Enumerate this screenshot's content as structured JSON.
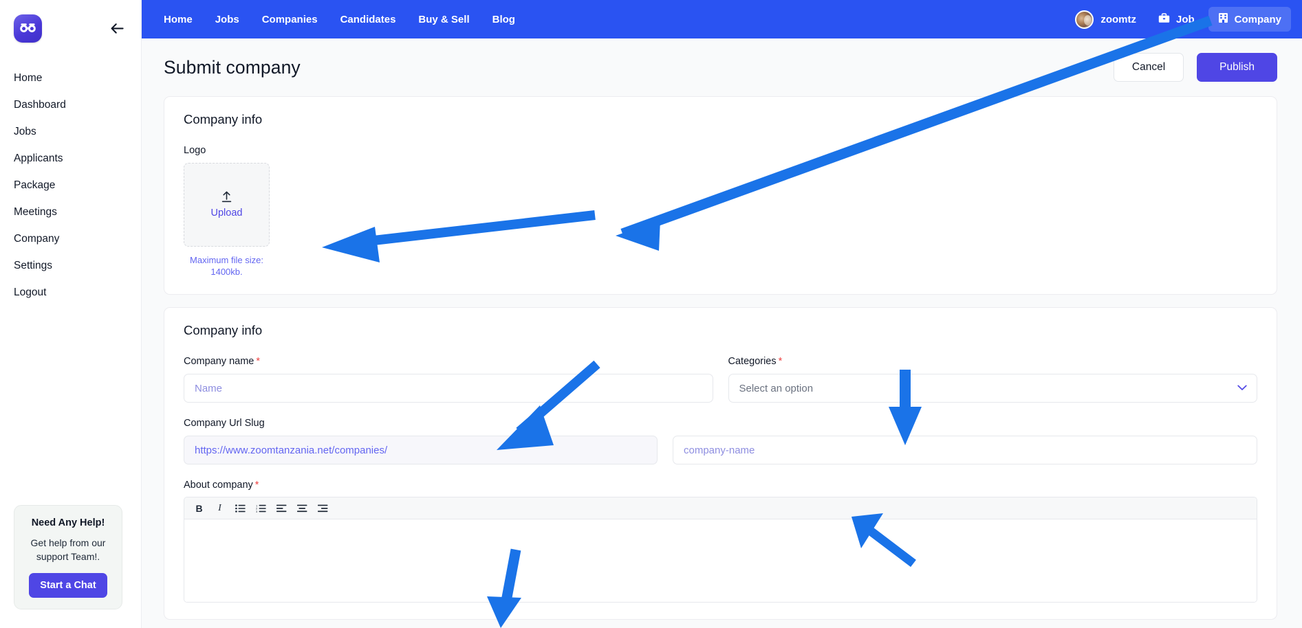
{
  "sidebar": {
    "logo_icon": "binoculars-logo-icon",
    "collapse_icon": "arrow-left-icon",
    "items": [
      {
        "label": "Home"
      },
      {
        "label": "Dashboard"
      },
      {
        "label": "Jobs"
      },
      {
        "label": "Applicants"
      },
      {
        "label": "Package"
      },
      {
        "label": "Meetings"
      },
      {
        "label": "Company"
      },
      {
        "label": "Settings"
      },
      {
        "label": "Logout"
      }
    ],
    "help": {
      "title": "Need Any Help!",
      "subtitle": "Get help from our support Team!.",
      "button": "Start a Chat"
    }
  },
  "topnav": {
    "background": "#2a53f2",
    "links": [
      {
        "label": "Home"
      },
      {
        "label": "Jobs"
      },
      {
        "label": "Companies"
      },
      {
        "label": "Candidates"
      },
      {
        "label": "Buy & Sell"
      },
      {
        "label": "Blog"
      }
    ],
    "user": {
      "name": "zoomtz",
      "avatar_icon": "user-avatar"
    },
    "actions": [
      {
        "label": "Job",
        "icon": "briefcase-icon",
        "active": false
      },
      {
        "label": "Company",
        "icon": "building-icon",
        "active": true
      }
    ]
  },
  "header": {
    "title": "Submit company",
    "cancel_label": "Cancel",
    "publish_label": "Publish",
    "publish_color": "#4f46e5"
  },
  "logo_card": {
    "title": "Company info",
    "logo_label": "Logo",
    "upload_label": "Upload",
    "upload_icon": "upload-arrow-icon",
    "max_size_hint": "Maximum file size: 1400kb."
  },
  "info_card": {
    "title": "Company info",
    "company_name": {
      "label": "Company name",
      "required": "*",
      "placeholder": "Name",
      "value": ""
    },
    "categories": {
      "label": "Categories",
      "required": "*",
      "selected": "Select an option",
      "chevron_icon": "chevron-down-icon"
    },
    "url_slug": {
      "label": "Company Url Slug",
      "prefix": "https://www.zoomtanzania.net/companies/",
      "placeholder": "company-name",
      "value": ""
    },
    "about": {
      "label": "About company",
      "required": "*",
      "toolbar": [
        {
          "name": "bold-icon",
          "glyph": "B"
        },
        {
          "name": "italic-icon",
          "glyph": "I"
        },
        {
          "name": "bullet-list-icon",
          "glyph": ""
        },
        {
          "name": "numbered-list-icon",
          "glyph": ""
        },
        {
          "name": "align-left-icon",
          "glyph": ""
        },
        {
          "name": "align-center-icon",
          "glyph": ""
        },
        {
          "name": "align-right-icon",
          "glyph": ""
        }
      ],
      "value": ""
    }
  },
  "annotations": {
    "arrow_color": "#1a73e8",
    "count": 5
  }
}
